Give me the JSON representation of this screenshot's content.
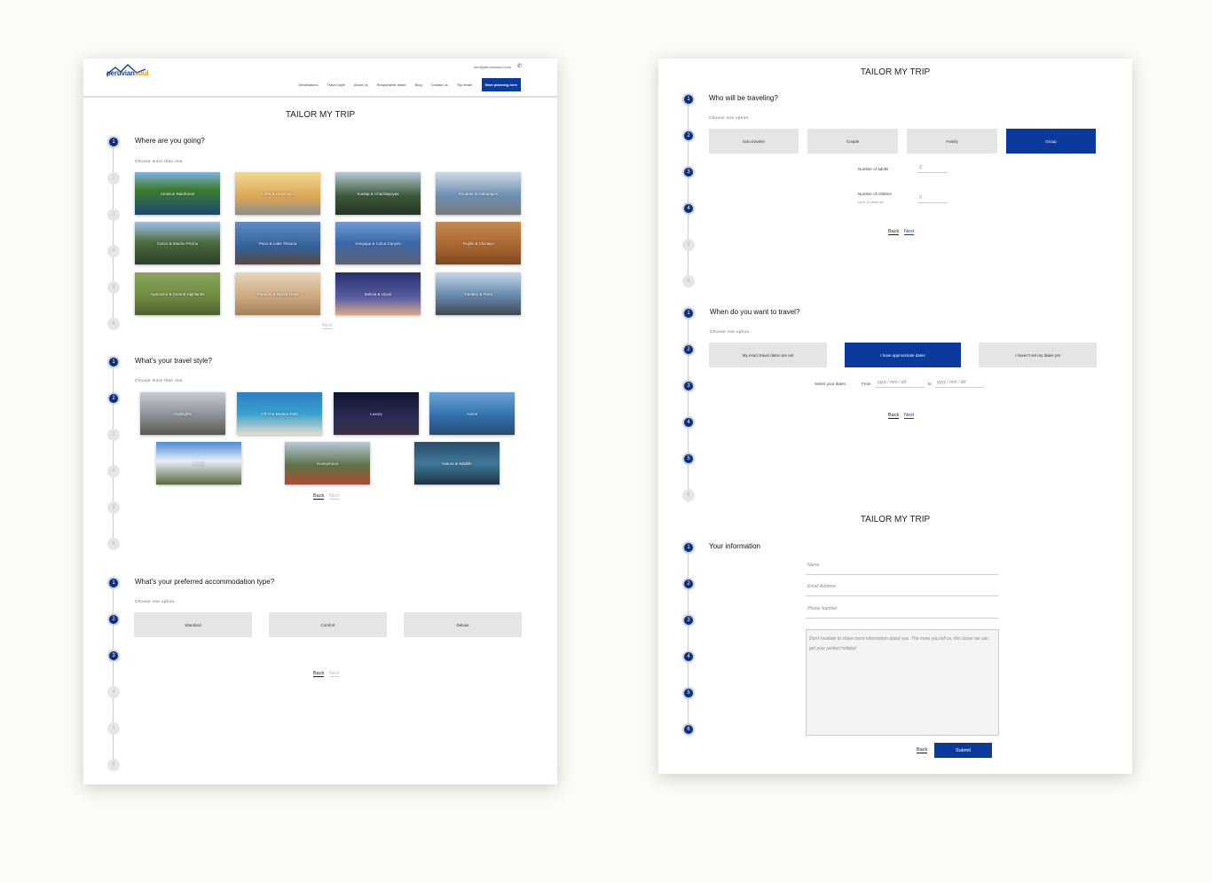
{
  "header": {
    "logo_main": "peruvian",
    "logo_accent": "soul",
    "email": "info@peruviansoul.com",
    "phone_icon": "phone-icon",
    "nav": [
      "Destinations",
      "Travel style",
      "About us",
      "Responsible travel",
      "Blog",
      "Contact us",
      "Trip finder"
    ],
    "cta": "Start planning here"
  },
  "title": "TAILOR MY TRIP",
  "steps": [
    "1",
    "2",
    "3",
    "4",
    "5",
    "6"
  ],
  "destinations": {
    "question": "Where are you going?",
    "hint": "Choose more than one.",
    "items": [
      "Amazon Rainforest",
      "Lima & Huancayo",
      "Kuelap & Chachapoyas",
      "Ecuador & Galapagos",
      "Cusco & Machu Picchu",
      "Puno & Lake Titicaca",
      "Arequipa & Colca Canyon",
      "Trujillo & Chiclayo",
      "Ayacucho & Central Highlands",
      "Paracas & Nazca Lines",
      "Bolivia & Uyuni",
      "Tumbes & Piura"
    ],
    "next": "Next"
  },
  "style": {
    "question": "What's your travel style?",
    "hint": "Choose more than one.",
    "items": [
      "Highlights",
      "Off-The-Beaten-Path",
      "Luxury",
      "Active",
      "Family",
      "Honeymoon",
      "Nature & Wildlife"
    ],
    "back": "Back",
    "next": "Next"
  },
  "accommodation": {
    "question": "What's your preferred accommodation type?",
    "hint": "Choose one option.",
    "items": [
      "Standard",
      "Comfort",
      "Deluxe"
    ],
    "back": "Back",
    "next": "Next"
  },
  "travelers": {
    "question": "Who will be traveling?",
    "hint": "Choose one option.",
    "items": [
      "Solo traveler",
      "Couple",
      "Family",
      "Group"
    ],
    "selected": "Group",
    "adults_label": "Number of adults",
    "adults_value": "2",
    "children_label": "Number of children",
    "children_sub": "Up to 11 years old",
    "children_value": "0",
    "back": "Back",
    "next": "Next"
  },
  "dates": {
    "question": "When do you want to travel?",
    "hint": "Choose one option.",
    "items": [
      "My exact travel dates are set",
      "I have approximate dates",
      "I haven't set my dates yet"
    ],
    "selected": "I have approximate dates",
    "select_label": "Select your dates:",
    "from": "From",
    "to": "to",
    "placeholder": "yyyy / mm / dd",
    "back": "Back",
    "next": "Next"
  },
  "info": {
    "question": "Your information",
    "name": "Name",
    "email": "Email Address",
    "phone": "Phone Number",
    "message": "Don't hesitate to share more information about you. The more you tell us, the closer we can get your perfect holiday!",
    "back": "Back",
    "submit": "Submit"
  },
  "colors": {
    "primary": "#0c3a9c",
    "step_active": "#0d2f74",
    "option_bg": "#e5e5e5"
  }
}
